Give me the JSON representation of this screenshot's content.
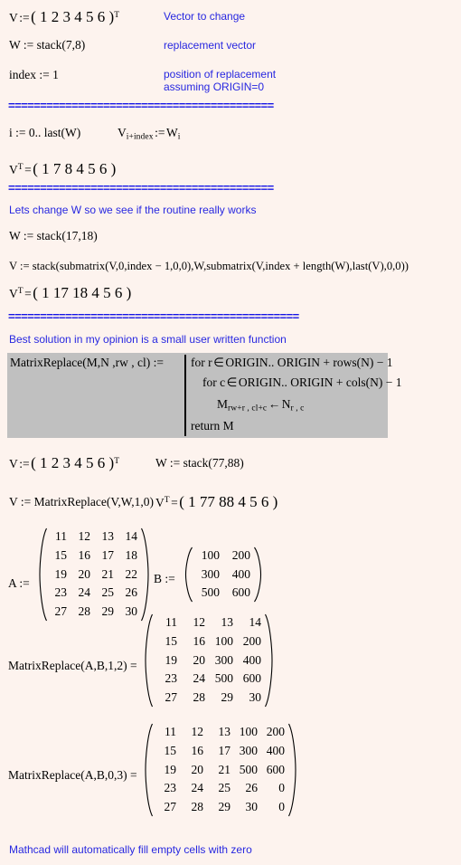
{
  "document": {
    "type": "mathcad-worksheet",
    "background_color": "#fdf3ee",
    "math_text_color": "#000000",
    "annotation_color": "#2727e0",
    "function_box_color": "#c0c0c0"
  },
  "annotations": {
    "vector_to_change": "Vector to change",
    "replacement_vector": "replacement vector",
    "position_line1": "position of replacement",
    "position_line2": "assuming ORIGIN=0",
    "lets_change_w": "Lets change W so we see if the routine really works",
    "best_solution": "Best solution in my opinion is a small user written function",
    "mathcad_fill": "Mathcad will automatically fill empty cells with zero"
  },
  "separators": {
    "sep1": "==========================================",
    "sep2": "==========================================",
    "sep3": "=============================================="
  },
  "definitions": {
    "v_def_label": "V",
    "v_def_assign": ":=",
    "v_def_values": "( 1  2  3  4  5  6 )",
    "v_def_transpose": "T",
    "w_def": "W  :=  stack(7,8)",
    "index_def": "index  :=  1",
    "i_range": "i  :=  0.. last(W)",
    "v_sub_assign_base": "V",
    "v_sub_assign_sub": "i+index",
    "v_sub_assign_op": ":=",
    "v_sub_assign_rhs": "W",
    "v_sub_assign_rhs_sub": "i",
    "vt_result1_values": "( 1  7  8  4  5  6 )",
    "w_def2": "W  :=  stack(17,18)",
    "v_stack_expr": "V  :=  stack(submatrix(V,0,index − 1,0,0),W,submatrix(V,index + length(W),last(V),0,0))",
    "vt_result2_values": "( 1  17  18  4  5  6 )",
    "v_def2_values": "( 1  2  3  4  5  6 )",
    "w_def3": "W  :=  stack(77,88)",
    "v_matrixreplace": "V  :=  MatrixReplace(V,W,1,0)",
    "vt_result3_values": "( 1  77  88  4  5  6 )",
    "vt_label": "V",
    "vt_sup": "T",
    "vt_eq": "="
  },
  "function_definition": {
    "signature": "MatrixReplace(M,N ,rw , cl)  :=",
    "line1_pre": "for  r",
    "line1_in": "∈",
    "line1_post": "ORIGIN.. ORIGIN + rows(N) − 1",
    "line2_pre": "for  c",
    "line2_in": "∈",
    "line2_post": "ORIGIN.. ORIGIN + cols(N) − 1",
    "line3_m": "M",
    "line3_m_sub": "rw+r , cl+c",
    "line3_arrow": "←",
    "line3_n": "N",
    "line3_n_sub": "r , c",
    "line4": "return  M"
  },
  "matrices": {
    "A": {
      "label": "A  :=",
      "rows": [
        [
          "11",
          "12",
          "13",
          "14"
        ],
        [
          "15",
          "16",
          "17",
          "18"
        ],
        [
          "19",
          "20",
          "21",
          "22"
        ],
        [
          "23",
          "24",
          "25",
          "26"
        ],
        [
          "27",
          "28",
          "29",
          "30"
        ]
      ]
    },
    "B": {
      "label": "B  :=",
      "rows": [
        [
          "100",
          "200"
        ],
        [
          "300",
          "400"
        ],
        [
          "500",
          "600"
        ]
      ]
    },
    "result1": {
      "label": "MatrixReplace(A,B,1,2)  =",
      "rows": [
        [
          "11",
          "12",
          "13",
          "14"
        ],
        [
          "15",
          "16",
          "100",
          "200"
        ],
        [
          "19",
          "20",
          "300",
          "400"
        ],
        [
          "23",
          "24",
          "500",
          "600"
        ],
        [
          "27",
          "28",
          "29",
          "30"
        ]
      ]
    },
    "result2": {
      "label": "MatrixReplace(A,B,0,3)  =",
      "rows": [
        [
          "11",
          "12",
          "13",
          "100",
          "200"
        ],
        [
          "15",
          "16",
          "17",
          "300",
          "400"
        ],
        [
          "19",
          "20",
          "21",
          "500",
          "600"
        ],
        [
          "23",
          "24",
          "25",
          "26",
          "0"
        ],
        [
          "27",
          "28",
          "29",
          "30",
          "0"
        ]
      ]
    }
  }
}
